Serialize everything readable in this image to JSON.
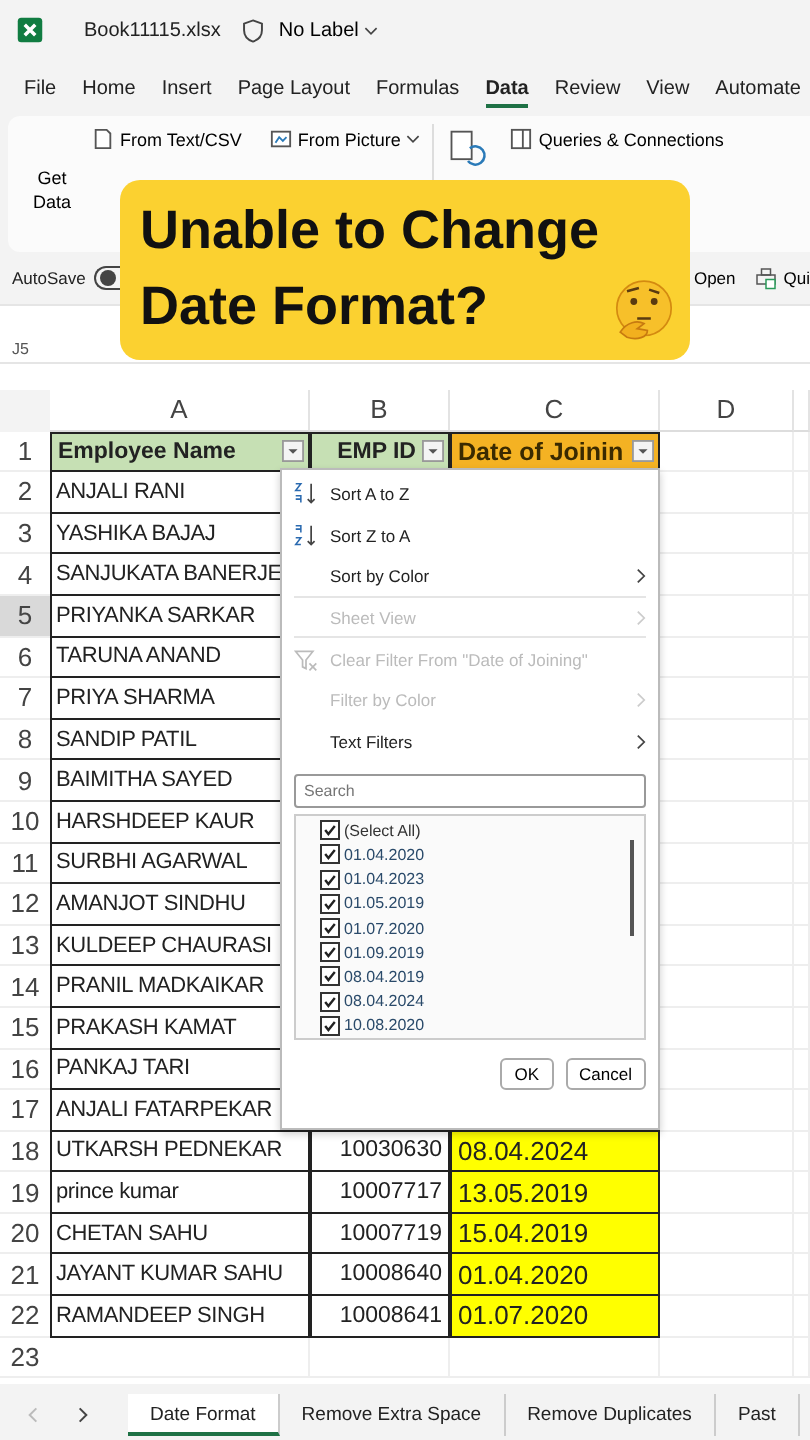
{
  "title_bar": {
    "file_name": "Book11115.xlsx",
    "label": "No Label"
  },
  "menu_tabs": [
    {
      "label": "File",
      "selected": false
    },
    {
      "label": "Home",
      "selected": false
    },
    {
      "label": "Insert",
      "selected": false
    },
    {
      "label": "Page Layout",
      "selected": false
    },
    {
      "label": "Formulas",
      "selected": false
    },
    {
      "label": "Data",
      "selected": true
    },
    {
      "label": "Review",
      "selected": false
    },
    {
      "label": "View",
      "selected": false
    },
    {
      "label": "Automate",
      "selected": false
    }
  ],
  "ribbon": {
    "get_data": "Get Data",
    "items": [
      "From Text/CSV",
      "From Picture",
      "Queries & Connections"
    ]
  },
  "quick_access": {
    "autosave": "AutoSave",
    "autosave_on": false,
    "open": "Open",
    "quick": "Qui"
  },
  "name_box": "J5",
  "caption": "Unable to Change Date Format?",
  "columns": [
    "A",
    "B",
    "C",
    "D"
  ],
  "header_row": {
    "number": "1",
    "cells": [
      "Employee Name",
      "EMP ID",
      "Date of Joinin"
    ]
  },
  "rows": [
    {
      "number": "2",
      "selected": false,
      "cells": [
        "ANJALI RANI"
      ]
    },
    {
      "number": "3",
      "selected": false,
      "cells": [
        "YASHIKA BAJAJ"
      ]
    },
    {
      "number": "4",
      "selected": false,
      "cells": [
        "SANJUKATA BANERJE"
      ]
    },
    {
      "number": "5",
      "selected": true,
      "cells": [
        "PRIYANKA SARKAR"
      ]
    },
    {
      "number": "6",
      "selected": false,
      "cells": [
        "TARUNA ANAND"
      ]
    },
    {
      "number": "7",
      "selected": false,
      "cells": [
        "PRIYA SHARMA"
      ]
    },
    {
      "number": "8",
      "selected": false,
      "cells": [
        "SANDIP PATIL"
      ]
    },
    {
      "number": "9",
      "selected": false,
      "cells": [
        "BAIMITHA SAYED"
      ]
    },
    {
      "number": "10",
      "selected": false,
      "cells": [
        "HARSHDEEP KAUR"
      ]
    },
    {
      "number": "11",
      "selected": false,
      "cells": [
        "SURBHI AGARWAL"
      ]
    },
    {
      "number": "12",
      "selected": false,
      "cells": [
        "AMANJOT SINDHU"
      ]
    },
    {
      "number": "13",
      "selected": false,
      "cells": [
        "KULDEEP CHAURASI"
      ]
    },
    {
      "number": "14",
      "selected": false,
      "cells": [
        "PRANIL MADKAIKAR"
      ]
    },
    {
      "number": "15",
      "selected": false,
      "cells": [
        "PRAKASH KAMAT"
      ]
    },
    {
      "number": "16",
      "selected": false,
      "cells": [
        "PANKAJ TARI"
      ]
    },
    {
      "number": "17",
      "selected": false,
      "cells": [
        "ANJALI FATARPEKAR"
      ]
    },
    {
      "number": "18",
      "selected": false,
      "cells": [
        "UTKARSH PEDNEKAR",
        "10030630",
        "08.04.2024"
      ]
    },
    {
      "number": "19",
      "selected": false,
      "cells": [
        "prince kumar",
        "10007717",
        "13.05.2019"
      ]
    },
    {
      "number": "20",
      "selected": false,
      "cells": [
        "CHETAN SAHU",
        "10007719",
        "15.04.2019"
      ]
    },
    {
      "number": "21",
      "selected": false,
      "cells": [
        "JAYANT KUMAR SAHU",
        "10008640",
        "01.04.2020"
      ]
    },
    {
      "number": "22",
      "selected": false,
      "cells": [
        "RAMANDEEP SINGH",
        "10008641",
        "01.07.2020"
      ]
    },
    {
      "number": "23",
      "selected": false,
      "cells": []
    }
  ],
  "filter_menu": {
    "items": [
      {
        "kind": "sort-asc",
        "label": "Sort A to Z",
        "disabled": false,
        "submenu": false,
        "divider_after": false
      },
      {
        "kind": "sort-desc",
        "label": "Sort Z to A",
        "disabled": false,
        "submenu": false,
        "divider_after": false
      },
      {
        "kind": "plain",
        "label": "Sort by Color",
        "disabled": false,
        "submenu": true,
        "divider_after": true
      },
      {
        "kind": "plain",
        "label": "Sheet View",
        "disabled": true,
        "submenu": true,
        "divider_after": true
      },
      {
        "kind": "clear-filter",
        "label": "Clear Filter From \"Date of Joining\"",
        "disabled": true,
        "submenu": false,
        "divider_after": false
      },
      {
        "kind": "plain",
        "label": "Filter by Color",
        "disabled": true,
        "submenu": true,
        "divider_after": false
      },
      {
        "kind": "plain",
        "label": "Text Filters",
        "disabled": false,
        "submenu": true,
        "divider_after": false
      }
    ],
    "search": {
      "placeholder": "Search"
    },
    "values": [
      {
        "label": "(Select All)",
        "checked": true
      },
      {
        "label": "01.04.2020",
        "checked": true
      },
      {
        "label": "01.04.2023",
        "checked": true
      },
      {
        "label": "01.05.2019",
        "checked": true
      },
      {
        "label": "01.07.2020",
        "checked": true
      },
      {
        "label": "01.09.2019",
        "checked": true
      },
      {
        "label": "08.04.2019",
        "checked": true
      },
      {
        "label": "08.04.2024",
        "checked": true
      },
      {
        "label": "10.08.2020",
        "checked": true
      }
    ],
    "buttons": [
      "OK",
      "Cancel"
    ]
  },
  "sheet_tabs": [
    {
      "label": "Date Format",
      "selected": true
    },
    {
      "label": "Remove Extra Space",
      "selected": false
    },
    {
      "label": "Remove Duplicates",
      "selected": false
    },
    {
      "label": "Past",
      "selected": false
    }
  ]
}
